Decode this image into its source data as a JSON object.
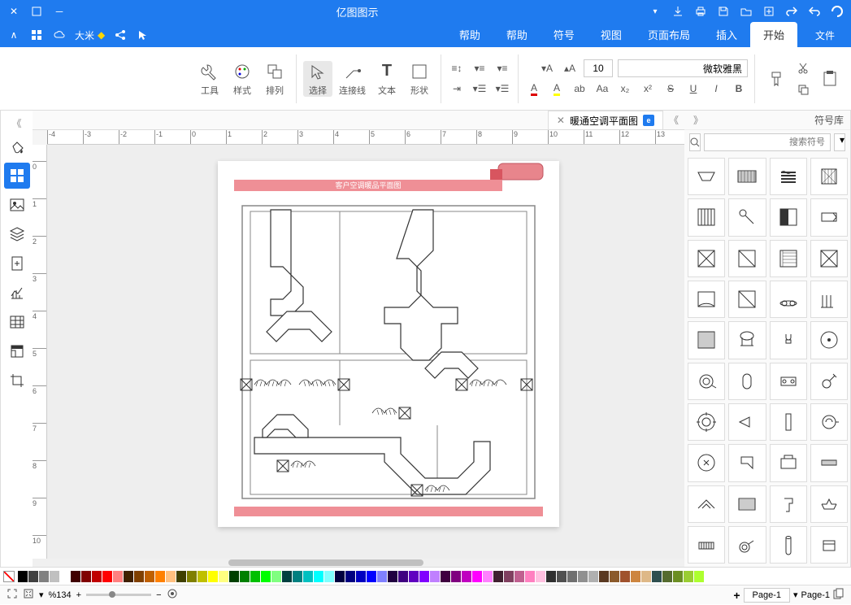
{
  "title": "亿图图示",
  "menu": {
    "file": "文件",
    "tabs": [
      "开始",
      "插入",
      "页面布局",
      "视图",
      "符号",
      "帮助",
      "帮助"
    ]
  },
  "quick": {
    "user_label": "大米"
  },
  "ribbon": {
    "clipboard": "",
    "tools": [
      {
        "label": "形状",
        "name": "shape-tool"
      },
      {
        "label": "文本",
        "name": "text-tool"
      },
      {
        "label": "连接线",
        "name": "connector-tool"
      },
      {
        "label": "选择",
        "name": "select-tool"
      },
      {
        "label": "排列",
        "name": "arrange-tool"
      },
      {
        "label": "样式",
        "name": "style-tool"
      },
      {
        "label": "工具",
        "name": "tools-tool"
      }
    ],
    "font_name": "微软雅黑",
    "font_size": "10"
  },
  "doc_tab": {
    "title": "暖通空调平面图"
  },
  "canvas": {
    "title_banner": "客户空调暖品平面图"
  },
  "shapes_panel": {
    "title": "符号库",
    "search_placeholder": "搜索符号"
  },
  "status": {
    "page_label": "Page-1",
    "page_tab": "Page-1",
    "zoom": "%134"
  },
  "ruler_marks_h": [
    "-4",
    "-3",
    "-2",
    "-1",
    "0",
    "1",
    "2",
    "3",
    "4",
    "5",
    "6",
    "7",
    "8",
    "9",
    "10",
    "11",
    "12",
    "13"
  ],
  "ruler_marks_v": [
    "0",
    "1",
    "2",
    "3",
    "4",
    "5",
    "6",
    "7",
    "8",
    "9",
    "10"
  ],
  "colors": [
    "#000000",
    "#404040",
    "#808080",
    "#c0c0c0",
    "#ffffff",
    "#400000",
    "#800000",
    "#c00000",
    "#ff0000",
    "#ff8080",
    "#402000",
    "#804000",
    "#c06000",
    "#ff8000",
    "#ffc080",
    "#404000",
    "#808000",
    "#c0c000",
    "#ffff00",
    "#ffff80",
    "#004000",
    "#008000",
    "#00c000",
    "#00ff00",
    "#80ff80",
    "#004040",
    "#008080",
    "#00c0c0",
    "#00ffff",
    "#80ffff",
    "#000040",
    "#000080",
    "#0000c0",
    "#0000ff",
    "#8080ff",
    "#200040",
    "#400080",
    "#6000c0",
    "#8000ff",
    "#c080ff",
    "#400040",
    "#800080",
    "#c000c0",
    "#ff00ff",
    "#ff80ff",
    "#402030",
    "#804060",
    "#c06090",
    "#ff80c0",
    "#ffc0e0",
    "#303030",
    "#505050",
    "#707070",
    "#909090",
    "#b0b0b0",
    "#5a3921",
    "#8b5a2b",
    "#a0522d",
    "#cd853f",
    "#deb887",
    "#2f4f4f",
    "#556b2f",
    "#6b8e23",
    "#9acd32",
    "#adff2f"
  ]
}
